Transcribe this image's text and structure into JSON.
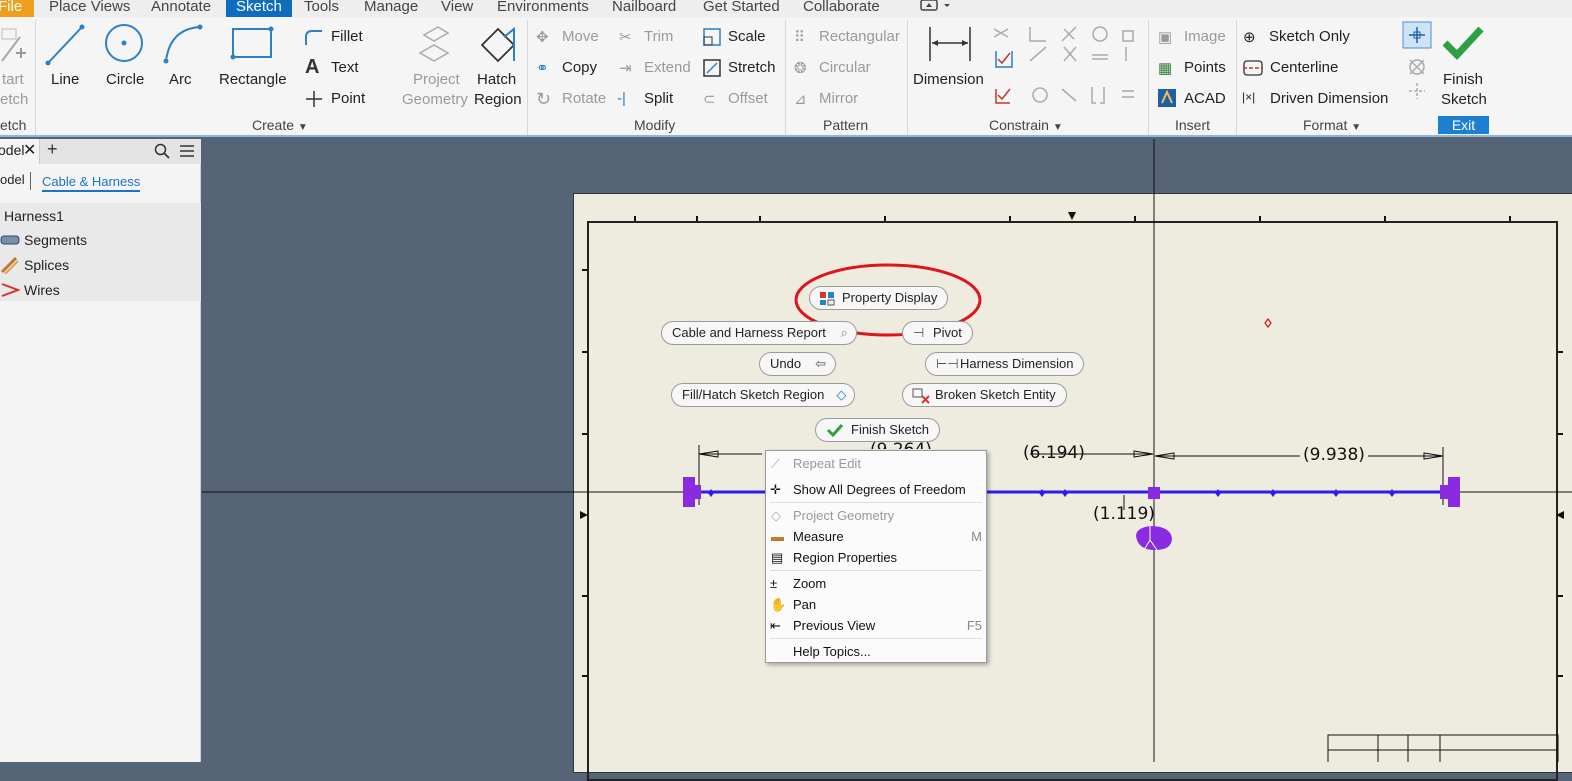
{
  "menu": [
    "File",
    "Place Views",
    "Annotate",
    "Sketch",
    "Tools",
    "Manage",
    "View",
    "Environments",
    "Nailboard",
    "Get Started",
    "Collaborate"
  ],
  "menu_active": "Sketch",
  "ribbon": {
    "start_sketch": [
      "tart",
      "etch"
    ],
    "create": {
      "line": "Line",
      "circle": "Circle",
      "arc": "Arc",
      "rectangle": "Rectangle",
      "fillet": "Fillet",
      "text": "Text",
      "point": "Point",
      "project_geometry": [
        "Project",
        "Geometry"
      ],
      "hatch_region": [
        "Hatch",
        "Region"
      ],
      "group": "Create"
    },
    "modify": {
      "move": "Move",
      "copy": "Copy",
      "rotate": "Rotate",
      "trim": "Trim",
      "extend": "Extend",
      "split": "Split",
      "scale": "Scale",
      "stretch": "Stretch",
      "offset": "Offset",
      "group": "Modify"
    },
    "pattern": {
      "rectangular": "Rectangular",
      "circular": "Circular",
      "mirror": "Mirror",
      "group": "Pattern"
    },
    "constrain": {
      "dimension": "Dimension",
      "group": "Constrain"
    },
    "insert": {
      "image": "Image",
      "points": "Points",
      "acad": "ACAD",
      "group": "Insert"
    },
    "format": {
      "sketch_only": "Sketch Only",
      "centerline": "Centerline",
      "driven_dimension": "Driven Dimension",
      "group": "Format"
    },
    "exit": {
      "finish": [
        "Finish",
        "Sketch"
      ],
      "group": "Exit"
    },
    "left_group": "etch"
  },
  "browser": {
    "tab": "odel",
    "subtab_model": "odel",
    "subtab_active": "Cable & Harness",
    "tree": [
      "Harness1",
      "Segments",
      "Splices",
      "Wires"
    ]
  },
  "marking_menu": {
    "property_display": "Property Display",
    "cable_report": "Cable and Harness Report",
    "pivot": "Pivot",
    "undo": "Undo",
    "harness_dimension": "Harness Dimension",
    "fill_hatch": "Fill/Hatch Sketch Region",
    "broken_entity": "Broken Sketch Entity",
    "finish_sketch": "Finish Sketch"
  },
  "context_menu": [
    {
      "label": "Repeat Edit",
      "key": "",
      "disabled": true
    },
    {
      "label": "Show All Degrees of Freedom",
      "key": "",
      "disabled": false
    },
    {
      "label": "Project Geometry",
      "key": "",
      "disabled": true
    },
    {
      "label": "Measure",
      "key": "M",
      "disabled": false
    },
    {
      "label": "Region Properties",
      "key": "",
      "disabled": false
    },
    {
      "label": "Zoom",
      "key": "",
      "disabled": false
    },
    {
      "label": "Pan",
      "key": "",
      "disabled": false
    },
    {
      "label": "Previous View",
      "key": "F5",
      "disabled": false
    },
    {
      "label": "Help Topics...",
      "key": "",
      "disabled": false
    }
  ],
  "dimensions": {
    "d1": "(6.194)",
    "d2": "(9.938)",
    "d3": "(1.119)",
    "d4": "(9.264)"
  },
  "colors": {
    "accent": "#0f6dbd",
    "highlight_ellipse": "#e0141c",
    "wire": "#2a1fe8",
    "node": "#8a2be2"
  }
}
